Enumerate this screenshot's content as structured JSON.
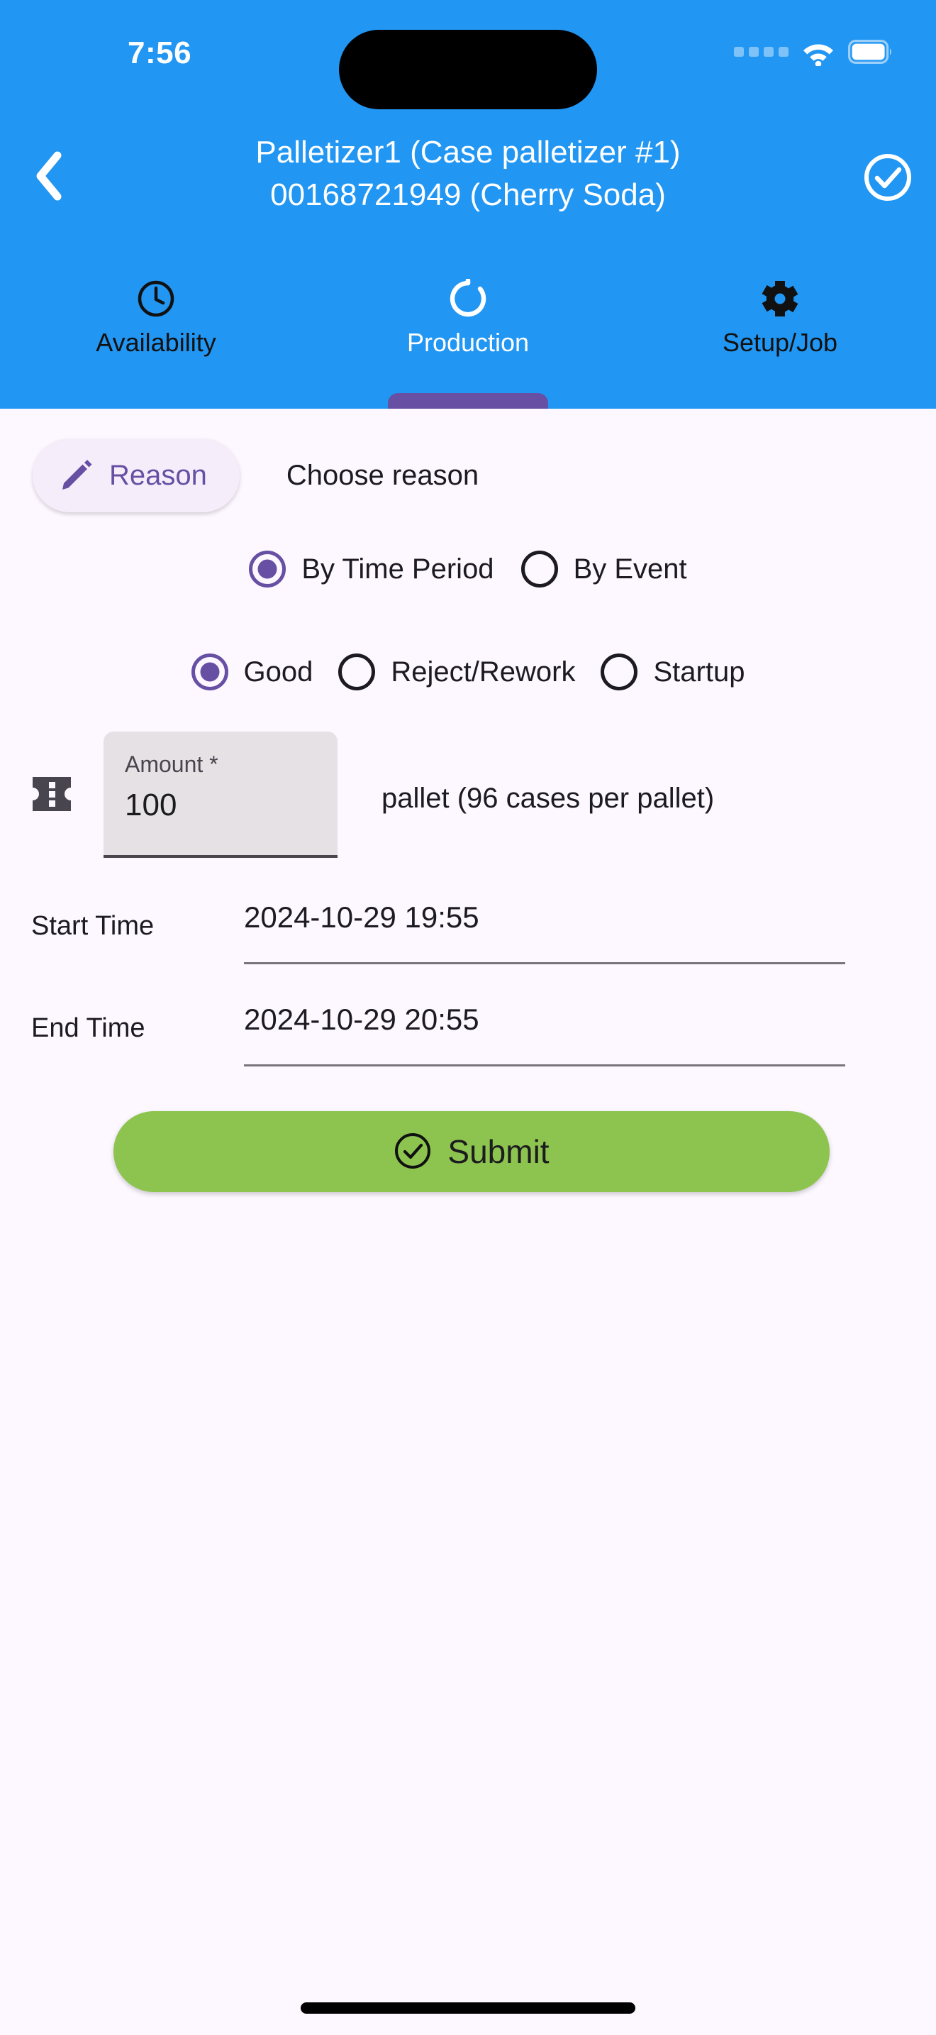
{
  "status_bar": {
    "time": "7:56",
    "cellular_icon": "cellular-dots-icon",
    "wifi_icon": "wifi-icon",
    "battery_icon": "battery-full-icon"
  },
  "header": {
    "background_color": "#2196f3",
    "back_icon": "chevron-left-icon",
    "confirm_icon": "check-circle-icon",
    "title_line1": "Palletizer1 (Case palletizer #1)",
    "title_line2": "00168721949 (Cherry Soda)",
    "tabs": [
      {
        "label": "Availability",
        "icon": "clock-icon",
        "active": false
      },
      {
        "label": "Production",
        "icon": "refresh-loading-icon",
        "active": true
      },
      {
        "label": "Setup/Job",
        "icon": "gear-icon",
        "active": false
      }
    ],
    "active_tab_indicator_color": "#6750a4"
  },
  "form": {
    "reason_chip_label": "Reason",
    "reason_chip_icon": "pencil-icon",
    "reason_chip_color": "#6750a4",
    "choose_reason_text": "Choose reason",
    "period_options": [
      {
        "label": "By Time Period",
        "selected": true
      },
      {
        "label": "By Event",
        "selected": false
      }
    ],
    "quality_options": [
      {
        "label": "Good",
        "selected": true
      },
      {
        "label": "Reject/Rework",
        "selected": false
      },
      {
        "label": "Startup",
        "selected": false
      }
    ],
    "amount": {
      "icon": "ticket-pallet-icon",
      "label": "Amount *",
      "value": "100",
      "unit_text": "pallet (96 cases per pallet)"
    },
    "start_time": {
      "label": "Start Time",
      "value": "2024-10-29 19:55"
    },
    "end_time": {
      "label": "End Time",
      "value": "2024-10-29 20:55"
    },
    "submit": {
      "label": "Submit",
      "icon": "check-circle-icon",
      "color": "#8cc44f"
    }
  }
}
